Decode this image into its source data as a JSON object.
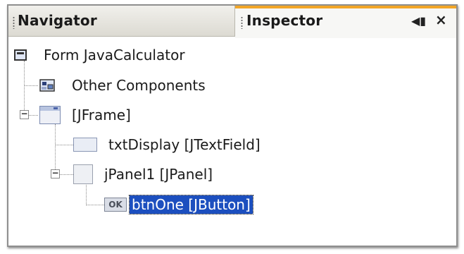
{
  "tabs": {
    "navigator_label": "Navigator",
    "inspector_label": "Inspector",
    "close_symbol": "×",
    "minimize_symbol": "◀▮"
  },
  "tree": {
    "form": {
      "label": "Form JavaCalculator",
      "icon": "form-icon"
    },
    "other": {
      "label": "Other Components",
      "icon": "other-components-icon"
    },
    "frame": {
      "label": "[JFrame]",
      "icon": "jframe-icon"
    },
    "txtDisplay": {
      "label": "txtDisplay [JTextField]",
      "icon": "textfield-icon"
    },
    "panel": {
      "label": "jPanel1 [JPanel]",
      "icon": "jpanel-icon"
    },
    "button": {
      "label": "btnOne [JButton]",
      "icon": "jbutton-icon",
      "icon_text": "OK",
      "selected": true
    }
  },
  "colors": {
    "active_tab_accent": "#f2a627",
    "selection": "#1c4fbf"
  }
}
